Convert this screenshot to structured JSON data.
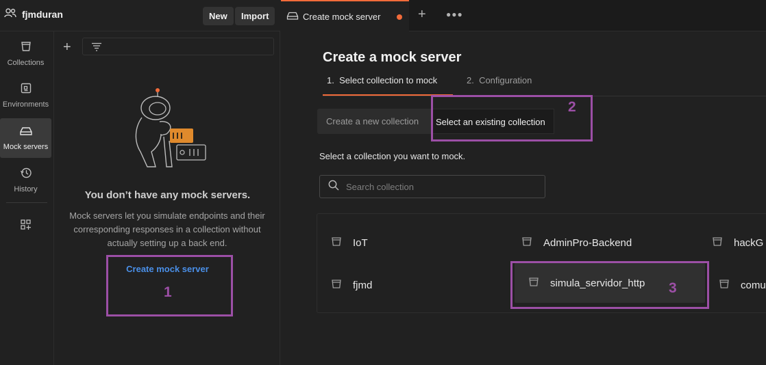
{
  "workspace": {
    "name": "fjmduran",
    "new_label": "New",
    "import_label": "Import"
  },
  "sidebar": {
    "items": [
      {
        "label": "Collections",
        "icon": "collections-icon"
      },
      {
        "label": "Environments",
        "icon": "environments-icon"
      },
      {
        "label": "Mock servers",
        "icon": "mock-servers-icon",
        "active": true
      },
      {
        "label": "History",
        "icon": "history-icon"
      }
    ],
    "configure_icon": "add-apps-icon"
  },
  "empty_state": {
    "title": "You don’t have any mock servers.",
    "description": "Mock servers let you simulate endpoints and their corresponding responses in a collection without actually setting up a back end.",
    "link": "Create mock server"
  },
  "tabs": [
    {
      "label": "Create mock server",
      "unsaved": true
    }
  ],
  "main": {
    "title": "Create a mock server",
    "steps": [
      {
        "label": "1.  Select collection to mock",
        "active": true
      },
      {
        "label": "2.  Configuration",
        "active": false
      }
    ],
    "segments": {
      "new_label": "Create a new collection",
      "existing_label": "Select an existing collection",
      "selected": "existing"
    },
    "prompt": "Select a collection you want to mock.",
    "search_placeholder": "Search collection",
    "collections": [
      {
        "name": "IoT"
      },
      {
        "name": "AdminPro-Backend"
      },
      {
        "name": "hackG"
      },
      {
        "name": "fjmd"
      },
      {
        "name": "simula_servidor_http",
        "highlighted": true
      },
      {
        "name": "comun"
      }
    ]
  },
  "annotations": [
    {
      "number": "1"
    },
    {
      "number": "2"
    },
    {
      "number": "3"
    }
  ],
  "colors": {
    "accent": "#f26b3a",
    "link": "#4a8fe7",
    "annotation": "#9c4fa6",
    "background": "#212121"
  }
}
